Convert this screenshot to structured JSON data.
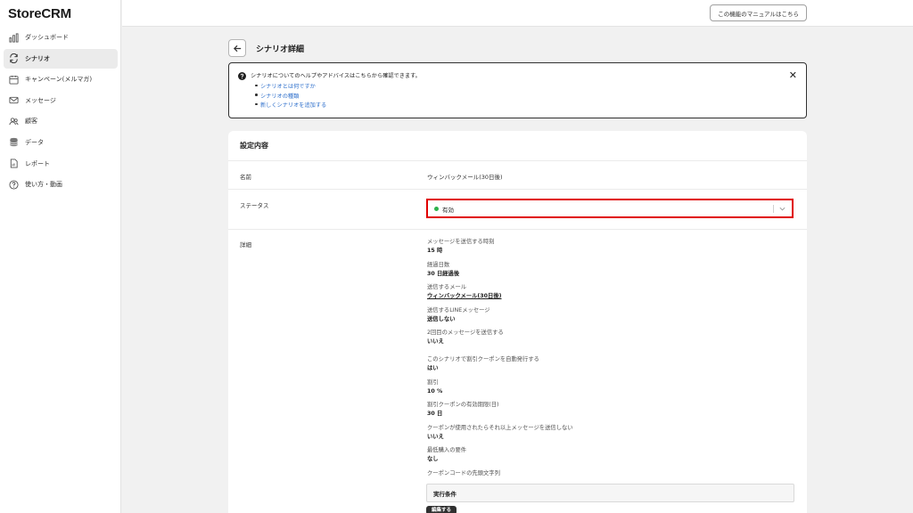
{
  "app": {
    "brand": "StoreCRM"
  },
  "sidebar": {
    "items": [
      {
        "label": "ダッシュボード",
        "icon": "bar-chart-icon",
        "active": false
      },
      {
        "label": "シナリオ",
        "icon": "refresh-icon",
        "active": true
      },
      {
        "label": "キャンペーン(メルマガ)",
        "icon": "calendar-icon",
        "active": false
      },
      {
        "label": "メッセージ",
        "icon": "mail-icon",
        "active": false
      },
      {
        "label": "顧客",
        "icon": "users-icon",
        "active": false
      },
      {
        "label": "データ",
        "icon": "database-icon",
        "active": false
      },
      {
        "label": "レポート",
        "icon": "report-icon",
        "active": false
      },
      {
        "label": "使い方・動画",
        "icon": "help-circle-icon",
        "active": false
      }
    ]
  },
  "topbar": {
    "manual_button": "この機能のマニュアルはこちら"
  },
  "header": {
    "title": "シナリオ詳細"
  },
  "help_banner": {
    "text": "シナリオについてのヘルプやアドバイスはこちらから確認できます。",
    "links": [
      "シナリオとは何ですか",
      "シナリオの種類",
      "新しくシナリオを追加する"
    ],
    "close": "✕"
  },
  "settings": {
    "title": "設定内容",
    "name_label": "名前",
    "name_value": "ウィンバックメール(30日後)",
    "status_label": "ステータス",
    "status_value": "有効",
    "status_color": "#2eb24c",
    "details_label": "詳細",
    "details": [
      {
        "label": "メッセージを送信する時刻",
        "value": "15 時"
      },
      {
        "label": "経過日数",
        "value": "30 日経過後"
      },
      {
        "label": "送信するメール",
        "value": "ウィンバックメール(30日後)",
        "link": true
      },
      {
        "label": "送信するLINEメッセージ",
        "value": "送信しない"
      },
      {
        "label": "2回目のメッセージを送信する",
        "value": "いいえ"
      },
      {
        "label": "このシナリオで割引クーポンを自動発行する",
        "value": "はい"
      },
      {
        "label": "割引",
        "value": "10 %"
      },
      {
        "label": "割引クーポンの有効期限(日)",
        "value": "30 日"
      },
      {
        "label": "クーポンが使用されたらそれ以上メッセージを送信しない",
        "value": "いいえ"
      },
      {
        "label": "最低購入の要件",
        "value": "なし"
      },
      {
        "label": "クーポンコードの先頭文字列",
        "value": ""
      }
    ],
    "condition_title": "実行条件",
    "edit_button": "編集する"
  }
}
